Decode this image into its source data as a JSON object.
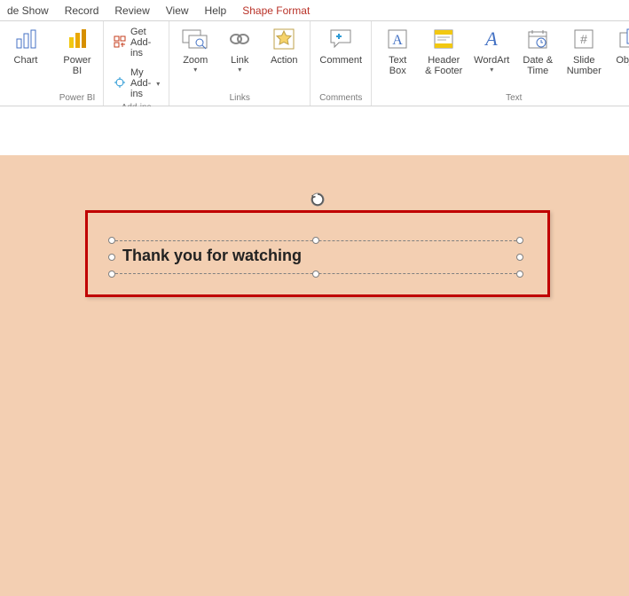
{
  "tabs": {
    "slideshow": "de Show",
    "record": "Record",
    "review": "Review",
    "view": "View",
    "help": "Help",
    "shape_format": "Shape Format"
  },
  "ribbon": {
    "chart": {
      "label": "Chart"
    },
    "powerbi": {
      "label": "Power\nBI",
      "group": "Power BI"
    },
    "addins": {
      "get": "Get Add-ins",
      "my": "My Add-ins",
      "group": "Add-ins"
    },
    "links": {
      "zoom": "Zoom",
      "link": "Link",
      "action": "Action",
      "group": "Links"
    },
    "comments": {
      "comment": "Comment",
      "group": "Comments"
    },
    "text": {
      "textbox": "Text\nBox",
      "header": "Header\n& Footer",
      "wordart": "WordArt",
      "datetime": "Date &\nTime",
      "slidenumber": "Slide\nNumber",
      "object": "Object",
      "group": "Text"
    }
  },
  "slide": {
    "text_content": "Thank you for watching"
  }
}
